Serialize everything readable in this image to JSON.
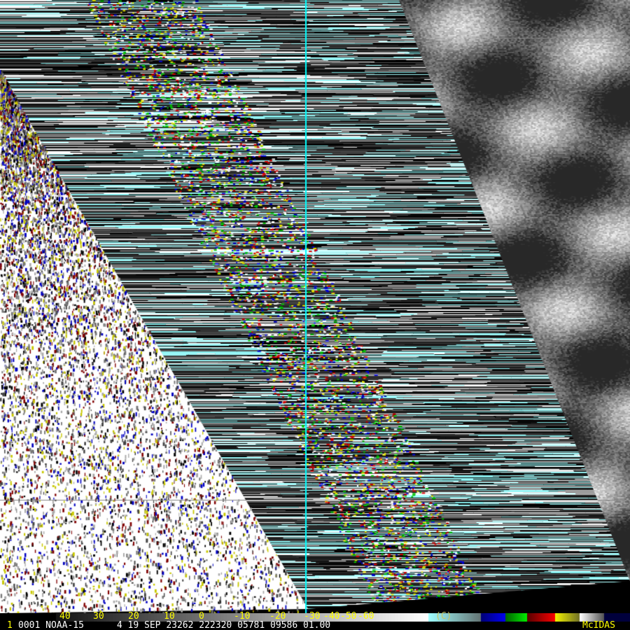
{
  "image": {
    "source": "NOAA-15",
    "overlay_line_color": "#00ffff"
  },
  "colorbar": {
    "labels": [
      "40",
      "30",
      "20",
      "10",
      "0",
      "-10",
      "-20",
      "-30",
      "-40",
      "-50",
      "-60"
    ],
    "unit": "(C)",
    "colors": {
      "blue": "#0000c8",
      "green": "#00c800",
      "red": "#c80000",
      "yellow": "#e6e600",
      "navy": "#000040",
      "cyan": "#a0ffff"
    }
  },
  "status": {
    "frame": "1",
    "text": "0001 NOAA-15      4 19 SEP 23262 222320 05781 09586 01.00",
    "brand": "McIDAS"
  }
}
